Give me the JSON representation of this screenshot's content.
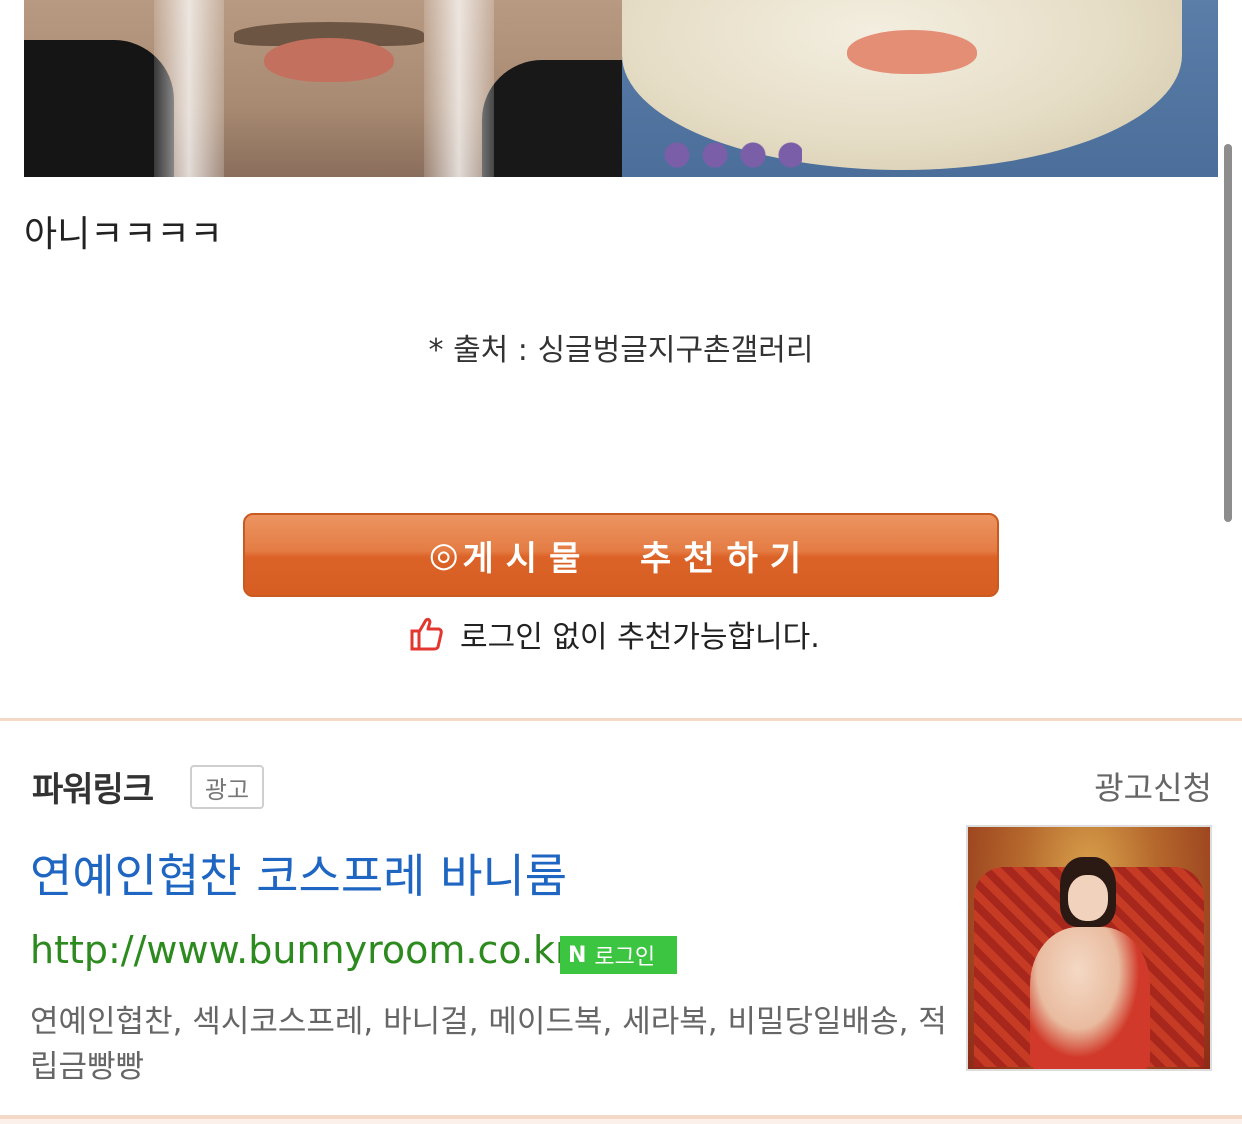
{
  "post": {
    "comment_text": "아니ㅋㅋㅋㅋ",
    "source_text": "* 출처 : 싱글벙글지구촌갤러리"
  },
  "recommend": {
    "button_symbol": "◎",
    "button_label": "게시물  추천하기",
    "note": "로그인 없이 추천가능합니다.",
    "accent_color": "#d65e22"
  },
  "powerlink": {
    "title": "파워링크",
    "ad_badge": "광고",
    "apply_label": "광고신청",
    "ad": {
      "title": "연예인협찬 코스프레 바니룸",
      "url": "http://www.bunnyroom.co.kr",
      "login_badge_icon": "N",
      "login_badge_label": "로그인",
      "description": "연예인협찬, 섹시코스프레, 바니걸, 메이드복, 세라복, 비밀당일배송, 적립금빵빵",
      "title_color": "#1f66c2",
      "url_color": "#2c8a1e"
    }
  }
}
